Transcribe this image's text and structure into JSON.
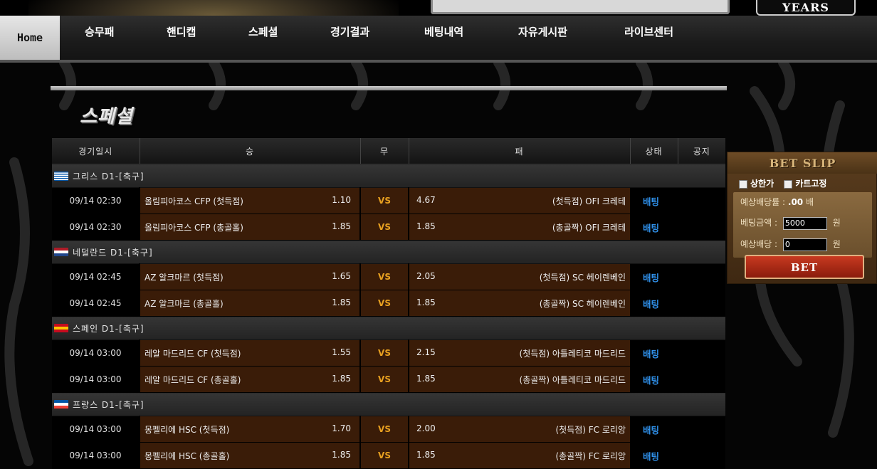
{
  "banner": {
    "years": "YEARS"
  },
  "nav": {
    "home": "Home",
    "items": [
      "승무패",
      "핸디캡",
      "스페셜",
      "경기결과",
      "베팅내역",
      "자유게시판",
      "라이브센터"
    ]
  },
  "page": {
    "title": "스페셜"
  },
  "table": {
    "headers": {
      "date": "경기일시",
      "home": "승",
      "draw": "무",
      "away": "패",
      "status": "상태",
      "notice": "공지"
    },
    "leagues": [
      {
        "label": "그리스 D1-[축구]",
        "flag_colors": [
          "#0d5eaf",
          "#ffffff"
        ],
        "games": [
          {
            "date": "09/14 02:30",
            "home": "올림피아코스 CFP (첫득점)",
            "home_odd": "1.10",
            "vs": "VS",
            "away_odd": "4.67",
            "away": "(첫득점) OFI 크레테",
            "status": "배팅"
          },
          {
            "date": "09/14 02:30",
            "home": "올림피아코스 CFP (총골홀)",
            "home_odd": "1.85",
            "vs": "VS",
            "away_odd": "1.85",
            "away": "(총골짝) OFI 크레테",
            "status": "배팅"
          }
        ]
      },
      {
        "label": "네덜란드 D1-[축구]",
        "flag_colors": [
          "#ae1c28",
          "#ffffff",
          "#21468b"
        ],
        "games": [
          {
            "date": "09/14 02:45",
            "home": "AZ 알크마르 (첫득점)",
            "home_odd": "1.65",
            "vs": "VS",
            "away_odd": "2.05",
            "away": "(첫득점) SC 헤이렌베인",
            "status": "배팅"
          },
          {
            "date": "09/14 02:45",
            "home": "AZ 알크마르 (총골홀)",
            "home_odd": "1.85",
            "vs": "VS",
            "away_odd": "1.85",
            "away": "(총골짝) SC 헤이렌베인",
            "status": "배팅"
          }
        ]
      },
      {
        "label": "스페인 D1-[축구]",
        "flag_colors": [
          "#c60b1e",
          "#ffc400",
          "#c60b1e"
        ],
        "games": [
          {
            "date": "09/14 03:00",
            "home": "레알 마드리드 CF (첫득점)",
            "home_odd": "1.55",
            "vs": "VS",
            "away_odd": "2.15",
            "away": "(첫득점) 아틀레티코 마드리드",
            "status": "배팅"
          },
          {
            "date": "09/14 03:00",
            "home": "레알 마드리드 CF (총골홀)",
            "home_odd": "1.85",
            "vs": "VS",
            "away_odd": "1.85",
            "away": "(총골짝) 아틀레티코 마드리드",
            "status": "배팅"
          }
        ]
      },
      {
        "label": "프랑스 D1-[축구]",
        "flag_colors": [
          "#0055a4",
          "#ffffff",
          "#ef4135"
        ],
        "games": [
          {
            "date": "09/14 03:00",
            "home": "몽펠리에 HSC (첫득점)",
            "home_odd": "1.70",
            "vs": "VS",
            "away_odd": "2.00",
            "away": "(첫득점) FC 로리앙",
            "status": "배팅"
          },
          {
            "date": "09/14 03:00",
            "home": "몽펠리에 HSC (총골홀)",
            "home_odd": "1.85",
            "vs": "VS",
            "away_odd": "1.85",
            "away": "(총골짝) FC 로리앙",
            "status": "배팅"
          }
        ]
      }
    ]
  },
  "betslip": {
    "title": "BET SLIP",
    "opt_maxodds": "상한가",
    "opt_cartfix": "카트고정",
    "odds_label": "예상배당률 :",
    "odds_value": ".00",
    "odds_unit": "배",
    "amount_label": "베팅금액 :",
    "amount_value": "5000",
    "amount_unit": "원",
    "payout_label": "예상배당 :",
    "payout_value": "0",
    "payout_unit": "원",
    "bet_button": "BET"
  }
}
